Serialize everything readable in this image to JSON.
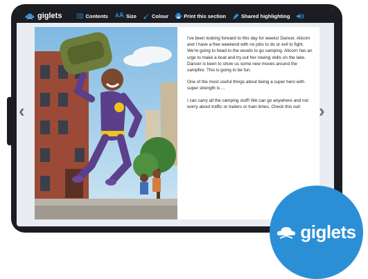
{
  "toolbar": {
    "brand": "giglets",
    "items": [
      {
        "label": "Contents",
        "icon": "list-icon"
      },
      {
        "label": "Size",
        "icon": "text-size-icon"
      },
      {
        "label": "Colour",
        "icon": "brush-icon"
      },
      {
        "label": "Print this section",
        "icon": "printer-icon"
      },
      {
        "label": "Shared highlighting",
        "icon": "highlighter-icon"
      }
    ],
    "audio_icon": "speaker-icon"
  },
  "story": {
    "paragraphs": [
      "I've been looking forward to this day for weeks! Dancer, Alicorn and I have a free weekend with no jobs to do or evil to fight. We're going to head to the woods to go camping. Alicorn has an urge to make a boat and try out her rowing skills on the lake. Dancer is keen to show us some new moves around the campfire. This is going to be fun.",
      "One of the most useful things about being a super hero with super strength is ...",
      "I can carry all the camping stuff! We can go anywhere and not worry about traffic or trailers or train times. Check this out!"
    ]
  },
  "navigation": {
    "prev": "‹",
    "next": "›"
  },
  "badge": {
    "text": "giglets",
    "icon": "cloud-book-icon"
  },
  "colors": {
    "accent": "#2b8fd6",
    "frame": "#1b1d22",
    "screen": "#e9edf1"
  }
}
